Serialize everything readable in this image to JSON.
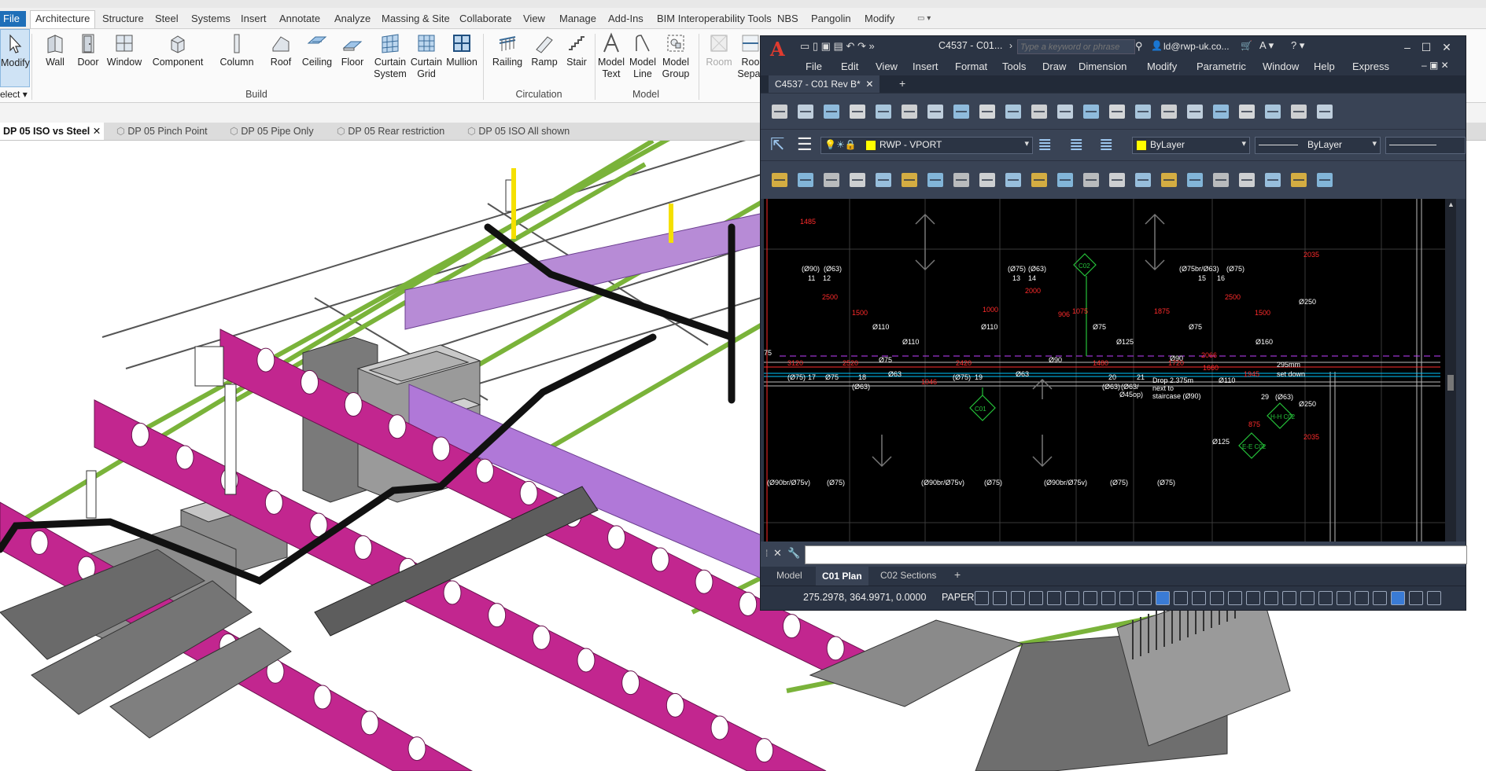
{
  "revit": {
    "tabs": [
      "File",
      "Architecture",
      "Structure",
      "Steel",
      "Systems",
      "Insert",
      "Annotate",
      "Analyze",
      "Massing & Site",
      "Collaborate",
      "View",
      "Manage",
      "Add-Ins",
      "BIM Interoperability Tools",
      "NBS",
      "Pangolin",
      "Modify"
    ],
    "ribbon_buttons": {
      "modify": "Modify",
      "wall": "Wall",
      "door": "Door",
      "window": "Window",
      "component": "Component",
      "column": "Column",
      "roof": "Roof",
      "ceiling": "Ceiling",
      "floor": "Floor",
      "curtain_system": "Curtain System",
      "curtain_grid": "Curtain Grid",
      "mullion": "Mullion",
      "railing": "Railing",
      "ramp": "Ramp",
      "stair": "Stair",
      "model_text": "Model Text",
      "model_line": "Model Line",
      "model_group": "Model Group",
      "room": "Room",
      "room_sep": "Roo Separ"
    },
    "select_label": "elect",
    "groups": {
      "build": "Build",
      "circulation": "Circulation",
      "model": "Model"
    },
    "views": [
      {
        "label": "DP 05 ISO vs Steel",
        "active": true
      },
      {
        "label": "DP 05 Pinch Point",
        "active": false
      },
      {
        "label": "DP 05 Pipe Only",
        "active": false
      },
      {
        "label": "DP 05 Rear restriction",
        "active": false
      },
      {
        "label": "DP 05 ISO All shown",
        "active": false
      }
    ]
  },
  "autocad": {
    "logo": "A",
    "title": "C4537 - C01...",
    "search_placeholder": "Type a keyword or phrase",
    "user": "ld@rwp-uk.co...",
    "menu": [
      "File",
      "Edit",
      "View",
      "Insert",
      "Format",
      "Tools",
      "Draw",
      "Dimension",
      "Modify",
      "Parametric",
      "Window",
      "Help",
      "Express"
    ],
    "doc_tab": "C4537 - C01 Rev B*",
    "layer": "RWP - VPORT",
    "color": "ByLayer",
    "linetype": "ByLayer",
    "layout_tabs": [
      "Model",
      "C01 Plan",
      "C02 Sections"
    ],
    "active_layout": "C01 Plan",
    "coordinates": "275.2978, 364.9971, 0.0000",
    "space": "PAPER",
    "drawing": {
      "labels": [
        "1485",
        "(Ø90)",
        "(Ø63)",
        "11",
        "12",
        "(Ø75)",
        "(Ø63)",
        "13",
        "14",
        "(Ø75br/Ø63)",
        "(Ø75)",
        "15",
        "16",
        "2500",
        "1500",
        "2000",
        "1000",
        "906",
        "1075",
        "1875",
        "2500",
        "1500",
        "2035",
        "Ø250",
        "Ø110",
        "Ø110",
        "Ø110",
        "Ø75",
        "Ø75",
        "Ø125",
        "Ø160",
        "75",
        "Ø75",
        "Ø90",
        "Ø90",
        "3120",
        "2520",
        "2420",
        "1480",
        "1720",
        "1660",
        "2066",
        "1945",
        "(Ø75)",
        "17",
        "Ø75",
        "18",
        "(Ø63)",
        "Ø63",
        "1046",
        "(Ø75)",
        "19",
        "Ø63",
        "20",
        "(Ø63)",
        "21",
        "(Ø63/",
        "Ø45op)",
        "Drop 2.375m",
        "next to",
        "staircase (Ø90)",
        "Ø110",
        "295mm",
        "set down",
        "29",
        "(Ø63)",
        "Ø250",
        "875",
        "Ø125",
        "2035",
        "(Ø90br/Ø75v)",
        "(Ø75)",
        "(Ø90br/Ø75v)",
        "(Ø75)",
        "(Ø90br/Ø75v)",
        "(Ø75)",
        "(Ø75)"
      ],
      "tags": [
        "C02",
        "C01",
        "H-H C02",
        "E-E C02"
      ]
    }
  }
}
